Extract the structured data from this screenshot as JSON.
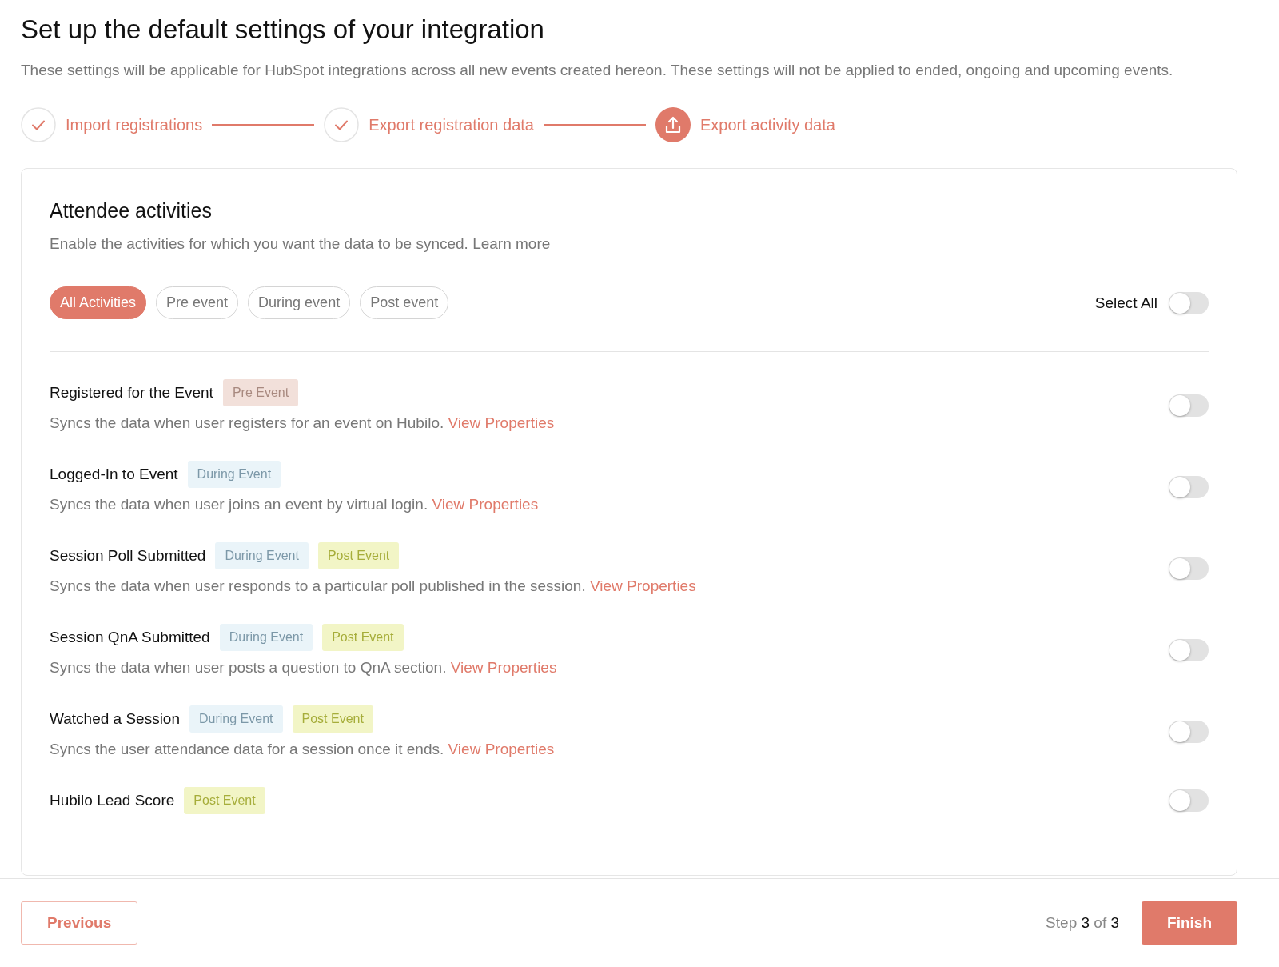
{
  "title": "Set up the default settings of your integration",
  "subtitle": "These settings will be applicable for HubSpot integrations across all new events created hereon. These settings will not be applied to ended, ongoing and upcoming events.",
  "steps": [
    {
      "label": "Import registrations",
      "completed": true
    },
    {
      "label": "Export registration data",
      "completed": true
    },
    {
      "label": "Export activity data",
      "completed": false
    }
  ],
  "card": {
    "heading": "Attendee activities",
    "description": "Enable the activities for which you want the data to be synced. Learn more",
    "filters": [
      {
        "label": "All Activities",
        "selected": true
      },
      {
        "label": "Pre event",
        "selected": false
      },
      {
        "label": "During event",
        "selected": false
      },
      {
        "label": "Post event",
        "selected": false
      }
    ],
    "select_all": {
      "label": "Select All",
      "on": false
    },
    "activities": [
      {
        "name": "Registered for the Event",
        "tags": [
          {
            "kind": "pre",
            "label": "Pre Event"
          }
        ],
        "description": "Syncs the data when user registers for an event on Hubilo.",
        "link": "View Properties",
        "on": false
      },
      {
        "name": "Logged-In to Event",
        "tags": [
          {
            "kind": "during",
            "label": "During Event"
          }
        ],
        "description": "Syncs the data when user joins an event by virtual login.",
        "link": "View Properties",
        "on": false
      },
      {
        "name": "Session Poll Submitted",
        "tags": [
          {
            "kind": "during",
            "label": "During Event"
          },
          {
            "kind": "post",
            "label": "Post Event"
          }
        ],
        "description": "Syncs the data when user responds to a particular poll published in the session.",
        "link": "View Properties",
        "on": false
      },
      {
        "name": "Session QnA Submitted",
        "tags": [
          {
            "kind": "during",
            "label": "During Event"
          },
          {
            "kind": "post",
            "label": "Post Event"
          }
        ],
        "description": "Syncs the data when user posts a question to QnA section.",
        "link": "View Properties",
        "on": false
      },
      {
        "name": "Watched a Session",
        "tags": [
          {
            "kind": "during",
            "label": "During Event"
          },
          {
            "kind": "post",
            "label": "Post Event"
          }
        ],
        "description": "Syncs the user attendance data for a session once it ends.",
        "link": "View Properties",
        "on": false
      },
      {
        "name": "Hubilo Lead Score",
        "tags": [
          {
            "kind": "post",
            "label": "Post Event"
          }
        ],
        "on": false
      }
    ]
  },
  "footer": {
    "previous": "Previous",
    "step": "Step **3** of **3**",
    "finish": "Finish"
  }
}
